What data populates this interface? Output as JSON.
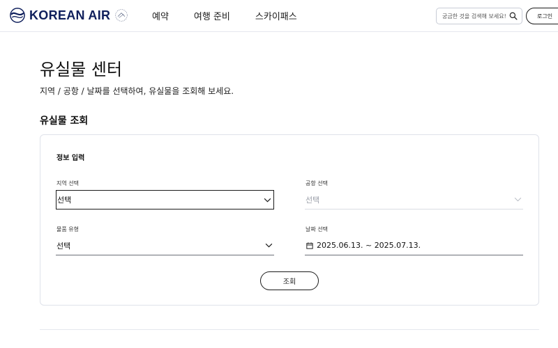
{
  "header": {
    "brand": "KOREAN AIR",
    "nav": [
      {
        "label": "예약"
      },
      {
        "label": "여행 준비"
      },
      {
        "label": "스카이패스"
      }
    ],
    "search": {
      "placeholder": "궁금한 것을 검색해 보세요!"
    },
    "login_label": "로그인",
    "brand_color": "#0f1f5c"
  },
  "main": {
    "title": "유실물 센터",
    "description": "지역 / 공항 / 날짜를 선택하여, 유실물을 조회해 보세요.",
    "section_title": "유실물 조회",
    "form": {
      "heading": "정보 입력",
      "region": {
        "label": "지역 선택",
        "value": "선택"
      },
      "airport": {
        "label": "공항 선택",
        "value": "선택"
      },
      "item_type": {
        "label": "물품 유형",
        "value": "선택"
      },
      "date": {
        "label": "날짜 선택",
        "value": "2025.06.13. ~ 2025.07.13."
      },
      "submit_label": "조회"
    }
  }
}
